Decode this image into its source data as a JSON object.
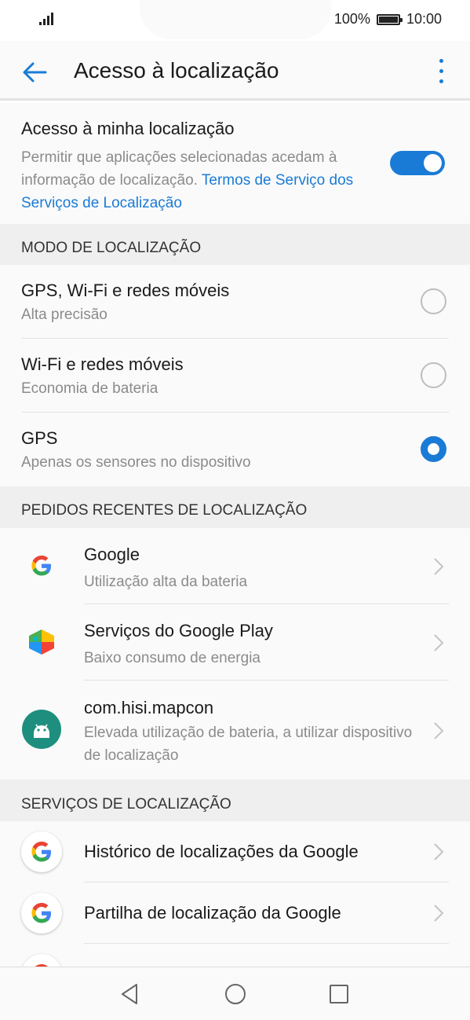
{
  "status_bar": {
    "battery_percent": "100%",
    "time": "10:00"
  },
  "app_bar": {
    "title": "Acesso à localização",
    "back_icon": "back-arrow-icon",
    "more_icon": "more-vertical-icon"
  },
  "location_access": {
    "title": "Acesso à minha localização",
    "description": "Permitir que aplicações selecionadas acedam à informação de localização. ",
    "link": "Termos de Serviço dos Serviços de Localização",
    "enabled": true
  },
  "location_mode": {
    "header": "MODO DE LOCALIZAÇÃO",
    "options": [
      {
        "title": "GPS, Wi-Fi e redes móveis",
        "subtitle": "Alta precisão",
        "selected": false
      },
      {
        "title": "Wi-Fi e redes móveis",
        "subtitle": "Economia de bateria",
        "selected": false
      },
      {
        "title": "GPS",
        "subtitle": "Apenas os sensores no dispositivo",
        "selected": true
      }
    ]
  },
  "recent_requests": {
    "header": "PEDIDOS RECENTES DE LOCALIZAÇÃO",
    "apps": [
      {
        "name": "Google",
        "detail": "Utilização alta da bateria",
        "icon": "google-icon"
      },
      {
        "name": "Serviços do Google Play",
        "detail": "Baixo consumo de energia",
        "icon": "google-play-services-icon"
      },
      {
        "name": "com.hisi.mapcon",
        "detail": "Elevada utilização de bateria, a utilizar dispositivo de localização",
        "icon": "android-icon"
      }
    ]
  },
  "location_services": {
    "header": "SERVIÇOS DE LOCALIZAÇÃO",
    "items": [
      {
        "name": "Histórico de localizações da Google",
        "icon": "google-icon"
      },
      {
        "name": "Partilha de localização da Google",
        "icon": "google-icon"
      }
    ]
  },
  "nav_bar": {
    "back_icon": "nav-back-icon",
    "home_icon": "nav-home-icon",
    "recents_icon": "nav-recents-icon"
  },
  "colors": {
    "accent": "#1a7bd6",
    "background": "#fafafa",
    "section_header_bg": "#efefef"
  }
}
